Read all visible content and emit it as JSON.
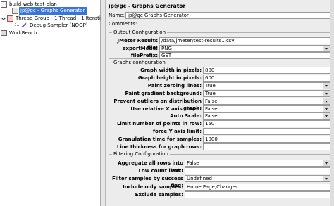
{
  "tree": {
    "root": "build-web-test-plan",
    "items": [
      "jp@gc - Graphs Generator",
      "Thread Group - 1 Thread - 1 Iteration",
      "Debug Sampler (NOOP)"
    ],
    "workbench": "WorkBench"
  },
  "panel": {
    "title": "jp@gc - Graphs Generator",
    "name_label": "Name:",
    "name_value": "jp@gc Graphs Generator",
    "comments_label": "Comments:"
  },
  "output": {
    "legend": "Output Configuration",
    "results_file_label": "JMeter Results file:",
    "results_file_value": "/data/jmeter/test-results1.csv",
    "export_mode_label": "exportMode:",
    "export_mode_value": "PNG",
    "file_prefix_label": "filePrefix:",
    "file_prefix_value": "GET"
  },
  "graphs": {
    "legend": "Graphs configuration",
    "rows": [
      {
        "label": "Graph width in pixels:",
        "value": "800",
        "dropdown": false
      },
      {
        "label": "Graph height in pixels:",
        "value": "600",
        "dropdown": false
      },
      {
        "label": "Paint zeroing lines:",
        "value": "True",
        "dropdown": true
      },
      {
        "label": "Paint gradient background:",
        "value": "True",
        "dropdown": true
      },
      {
        "label": "Prevent outliers on distribution graph:",
        "value": "False",
        "dropdown": true
      },
      {
        "label": "Use relative X axis times:",
        "value": "False",
        "dropdown": true
      },
      {
        "label": "Auto Scale:",
        "value": "False",
        "dropdown": true
      },
      {
        "label": "Limit number of points in row:",
        "value": "150",
        "dropdown": false
      },
      {
        "label": "force Y axis limit:",
        "value": "",
        "dropdown": false
      },
      {
        "label": "Granulation time for samples:",
        "value": "1000",
        "dropdown": false
      },
      {
        "label": "Line thickness for graph rows:",
        "value": "",
        "dropdown": false
      }
    ]
  },
  "filtering": {
    "legend": "Filtering Configuration",
    "rows": [
      {
        "label": "Aggregate all rows into one:",
        "value": "False",
        "dropdown": true
      },
      {
        "label": "Low count limit:",
        "value": "",
        "dropdown": false
      },
      {
        "label": "Filter samples by success flag:",
        "value": "Undefined",
        "dropdown": true
      },
      {
        "label": "Include only samples:",
        "value": "Home Page,Changes",
        "dropdown": false
      },
      {
        "label": "Exclude samples:",
        "value": "",
        "dropdown": false
      }
    ]
  }
}
